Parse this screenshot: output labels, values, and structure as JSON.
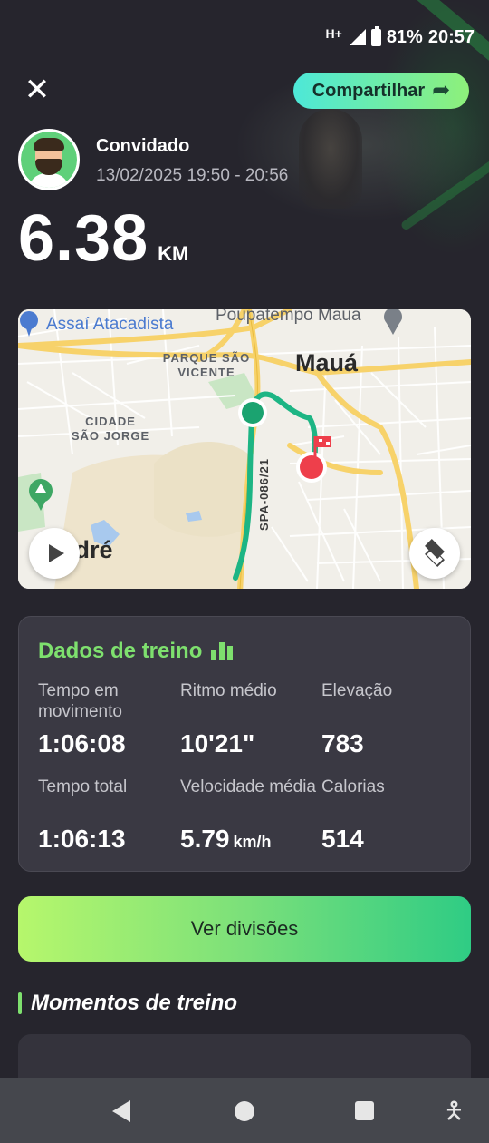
{
  "status_bar": {
    "network": "H+",
    "battery": "81%",
    "time": "20:57"
  },
  "header": {
    "close_icon": "close-icon",
    "share_label": "Compartilhar",
    "share_icon": "share-arrow-icon"
  },
  "user": {
    "name": "Convidado",
    "datetime": "13/02/2025 19:50 - 20:56"
  },
  "distance": {
    "value": "6.38",
    "unit": "KM"
  },
  "map": {
    "poi_top_left": "Assaí Atacadista",
    "poi_top_center": "Poupatempo Maua",
    "district_1": "PARQUE SÃO\nVICENTE",
    "district_2": "CIDADE\nSÃO JORGE",
    "city": "Mauá",
    "city_left": "ndré",
    "road_label": "SPA-086/21",
    "route_color": "#1db584",
    "start_color": "#1ba370",
    "end_color": "#ee3f4b"
  },
  "stats": {
    "title": "Dados de treino",
    "accent_color": "#7ee06e",
    "moving_time_label": "Tempo em movimento",
    "moving_time_value": "1:06:08",
    "avg_pace_label": "Ritmo médio",
    "avg_pace_value": "10'21\"",
    "elevation_label": "Elevação",
    "elevation_value": "783",
    "total_time_label": "Tempo total",
    "total_time_value": "1:06:13",
    "avg_speed_label": "Velocidade média",
    "avg_speed_value": "5.79",
    "avg_speed_unit": "km/h",
    "calories_label": "Calorias",
    "calories_value": "514"
  },
  "divisions_button": "Ver divisões",
  "moments": {
    "title": "Momentos de treino"
  },
  "nav": {
    "back_icon": "back-icon",
    "home_icon": "home-icon",
    "recents_icon": "recents-icon",
    "accessibility_icon": "accessibility-icon"
  }
}
